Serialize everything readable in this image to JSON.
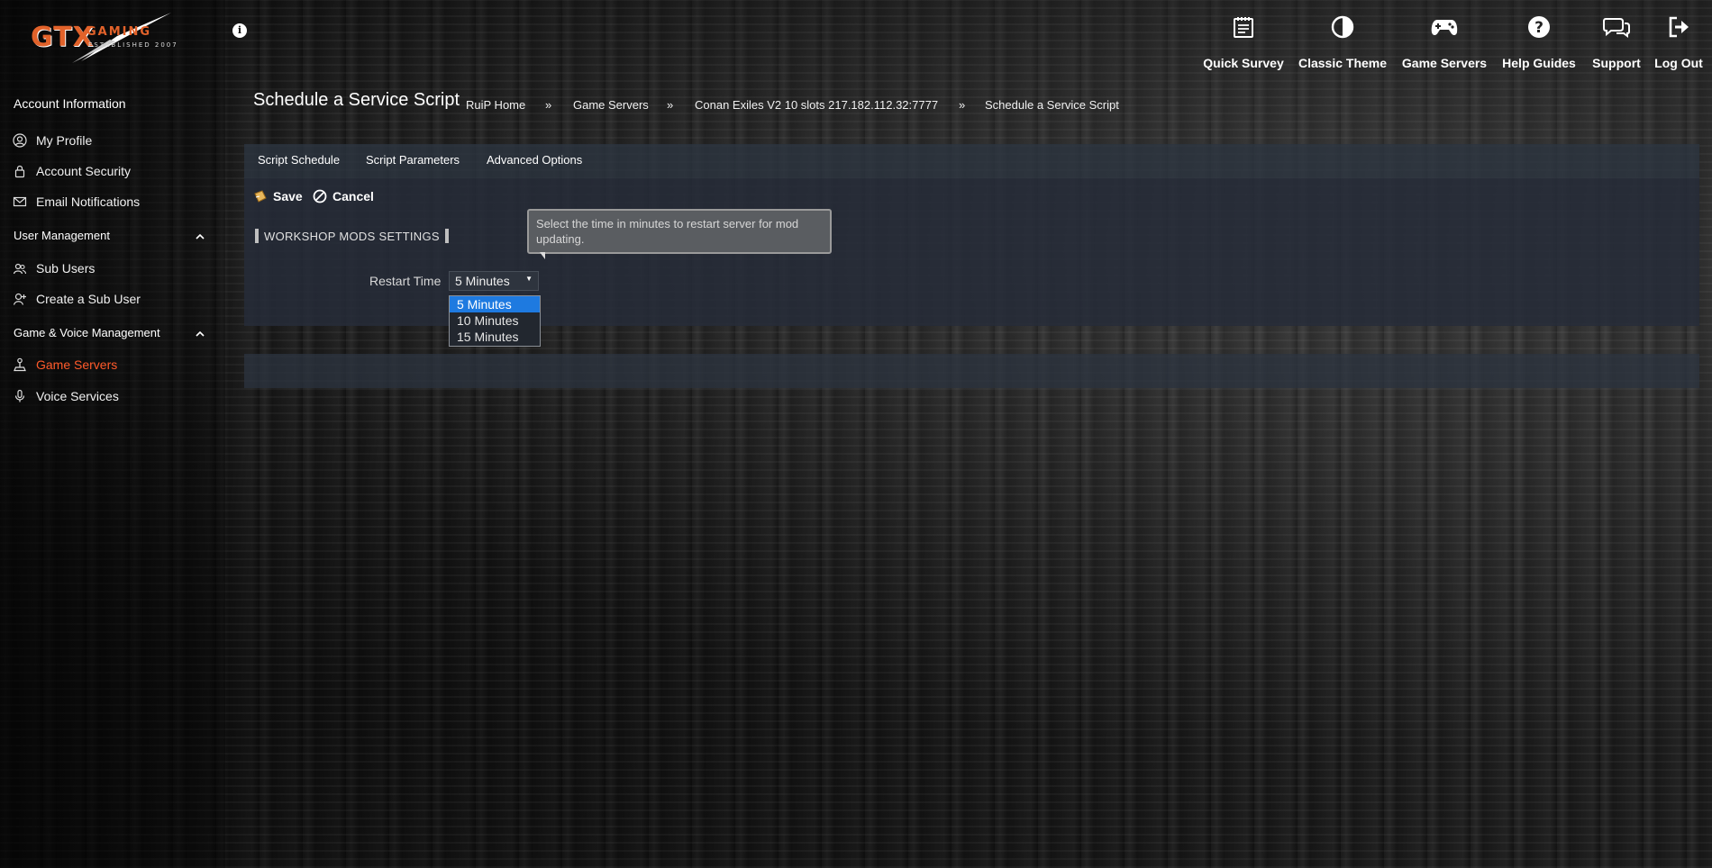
{
  "brand": {
    "logo_main": "GTX",
    "logo_sub": "GAMING",
    "logo_est": "ESTABLISHED 2007"
  },
  "header": {
    "nav": [
      {
        "label": "Quick Survey",
        "icon": "survey-icon"
      },
      {
        "label": "Classic Theme",
        "icon": "contrast-icon"
      },
      {
        "label": "Game Servers",
        "icon": "gamepad-icon"
      },
      {
        "label": "Help Guides",
        "icon": "question-icon"
      },
      {
        "label": "Support",
        "icon": "chat-icon"
      },
      {
        "label": "Log Out",
        "icon": "logout-icon"
      }
    ]
  },
  "sidebar": {
    "account_heading": "Account Information",
    "account_items": [
      {
        "label": "My Profile",
        "icon": "profile-icon"
      },
      {
        "label": "Account Security",
        "icon": "lock-icon"
      },
      {
        "label": "Email Notifications",
        "icon": "envelope-icon"
      }
    ],
    "user_mgmt_heading": "User Management",
    "user_mgmt_items": [
      {
        "label": "Sub Users",
        "icon": "users-icon"
      },
      {
        "label": "Create a Sub User",
        "icon": "add-user-icon"
      }
    ],
    "game_voice_heading": "Game & Voice Management",
    "game_voice_items": [
      {
        "label": "Game Servers",
        "icon": "joystick-icon",
        "active": true
      },
      {
        "label": "Voice Services",
        "icon": "microphone-icon"
      }
    ]
  },
  "page": {
    "title": "Schedule a Service Script",
    "breadcrumbs": [
      "RuiP Home",
      "Game Servers",
      "Conan Exiles V2 10 slots 217.182.112.32:7777",
      "Schedule a Service Script"
    ],
    "separator": "»"
  },
  "tabs": [
    "Script Schedule",
    "Script Parameters",
    "Advanced Options"
  ],
  "actions": {
    "save": "Save",
    "cancel": "Cancel"
  },
  "section": {
    "heading": "WORKSHOP MODS SETTINGS",
    "tooltip": "Select the time in minutes to restart server for mod updating.",
    "field_label": "Restart Time",
    "field_value": "5 Minutes",
    "options": [
      "5 Minutes",
      "10 Minutes",
      "15 Minutes"
    ],
    "selected_option": "5 Minutes"
  },
  "colors": {
    "accent_active": "#ff5a2a",
    "brand_orange": "#e2622a",
    "dropdown_highlight": "#1e7ae0"
  }
}
